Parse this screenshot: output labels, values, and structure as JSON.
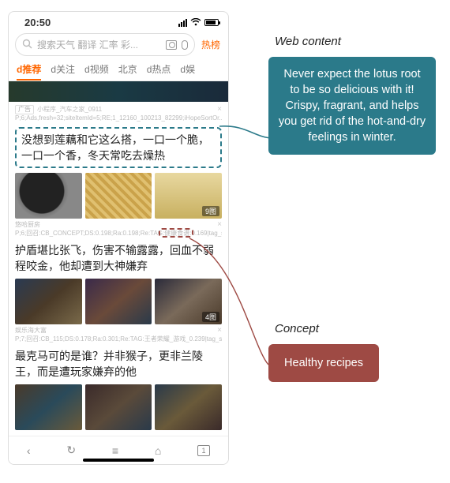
{
  "status": {
    "time": "20:50"
  },
  "search": {
    "placeholder": "搜索天气 翻译 汇率 彩...",
    "hot": "热榜"
  },
  "tabs": [
    "d推荐",
    "d关注",
    "d视频",
    "北京",
    "d热点",
    "d娱"
  ],
  "feed": {
    "ad": {
      "mark": "广告",
      "source": "小程序_汽车之家_0911",
      "debug": "P;6;Ads,fresh=32;siteItemId=5;RE;1_12160_100213_82299;iHopeSortOr..."
    },
    "post1": {
      "title": "没想到莲藕和它这么搭，一口一个脆，一口一个香，冬天常吃去燥热",
      "pic_badge": "9图",
      "source": "悠哈厨房",
      "debug": "P;6;回召:CB_CONCEPT;DS:0.198;Ra:0.198;Re:TAG:健康食谱:0.169|tag_s...",
      "concept_text": "健康食谱"
    },
    "post2": {
      "title": "护盾堪比张飞，伤害不输露露，回血不弱程咬金，他却遭到大神嫌弃",
      "pic_badge": "4图",
      "source": "娱乐海大富",
      "debug": "P;7;回召:CB_115;DS:0.178;Ra:0.301;Re:TAG:王者荣耀_游戏_0.239|tag_sim..."
    },
    "post3": {
      "title": "最克马可的是谁？并非猴子，更非兰陵王，而是遭玩家嫌弃的他"
    }
  },
  "botnav": {
    "back": "‹",
    "refresh": "↻",
    "menu": "≡",
    "home": "⌂",
    "tabs": "1"
  },
  "annot": {
    "web_label": "Web content",
    "web_text": "Never expect the lotus root to be so delicious with it! Crispy, fragrant, and helps you get rid of the hot-and-dry feelings in winter.",
    "concept_label": "Concept",
    "concept_text": "Healthy recipes"
  }
}
